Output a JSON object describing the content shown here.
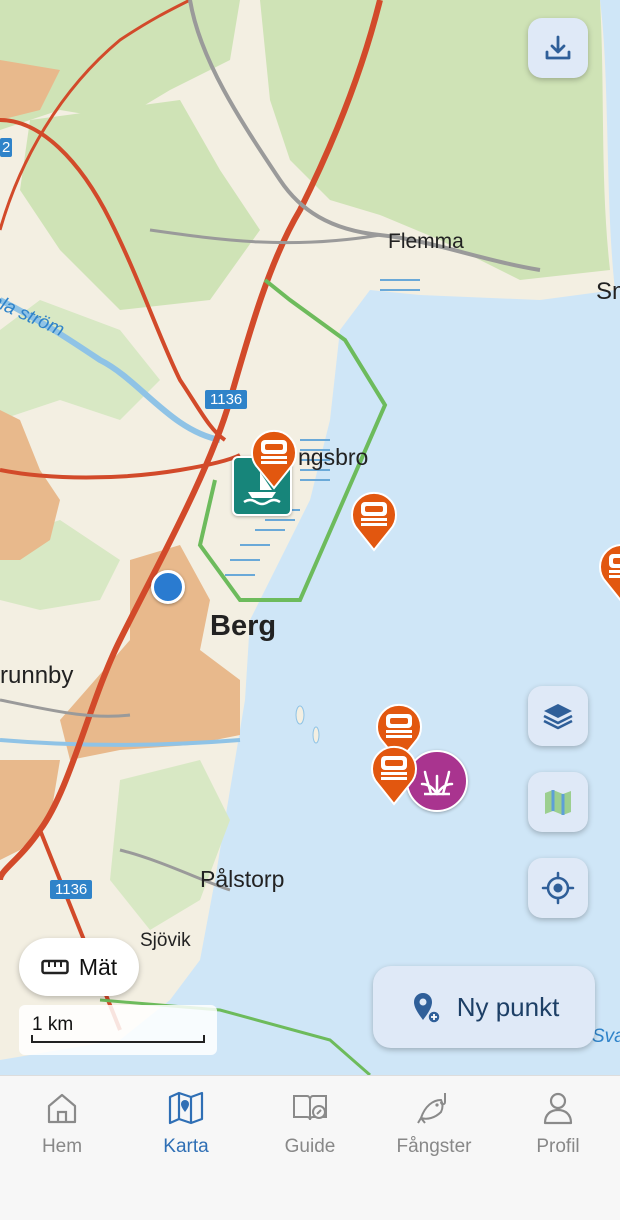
{
  "map": {
    "places": {
      "flemma": "Flemma",
      "sm": "Sm",
      "strom": "ala ström",
      "ingsbro": "ngsbro",
      "berg": "Berg",
      "brunnby": "runnby",
      "palstorp": "Pålstorp",
      "sjovik": "Sjövik",
      "sva": "Sva"
    },
    "road_numbers": [
      "1136",
      "1136"
    ],
    "edge_number": "2"
  },
  "controls": {
    "download_icon": "download-icon",
    "layers_icon": "layers-icon",
    "map_type_icon": "map-icon",
    "locate_icon": "crosshair-icon",
    "measure_label": "Mät",
    "scale_label": "1 km",
    "new_point_label": "Ny punkt"
  },
  "tabs": [
    {
      "label": "Hem",
      "icon": "home-icon",
      "active": false
    },
    {
      "label": "Karta",
      "icon": "map-icon",
      "active": true
    },
    {
      "label": "Guide",
      "icon": "book-icon",
      "active": false
    },
    {
      "label": "Fångster",
      "icon": "fish-icon",
      "active": false
    },
    {
      "label": "Profil",
      "icon": "person-icon",
      "active": false
    }
  ],
  "colors": {
    "water": "#cfe6f7",
    "land": "#f3efe2",
    "forest": "#cfe3b6",
    "pin_orange": "#e2570f",
    "pin_purple": "#a9348f",
    "boat_teal": "#17857a",
    "accent": "#2f6fb5"
  }
}
